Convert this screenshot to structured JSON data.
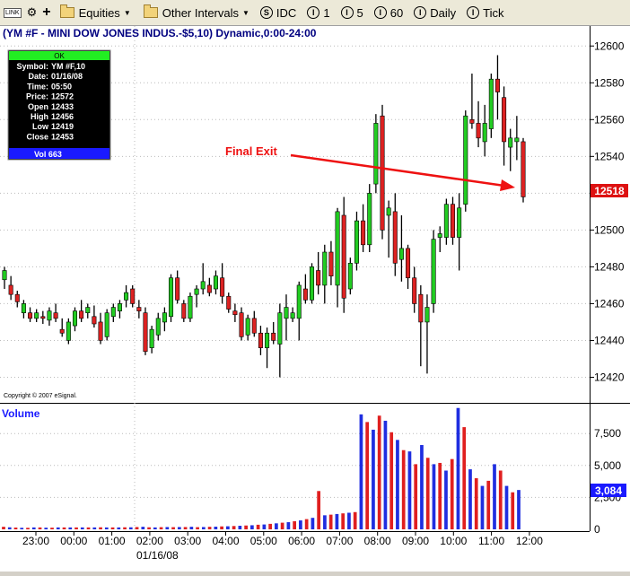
{
  "toolbar": {
    "link_label": "LINK",
    "items": [
      {
        "label": "Equities",
        "icon": "folder-icon",
        "dropdown": true
      },
      {
        "label": "Other Intervals",
        "icon": "folder-icon",
        "dropdown": true
      },
      {
        "label": "IDC",
        "icon": "S"
      },
      {
        "label": "1",
        "icon": "I"
      },
      {
        "label": "5",
        "icon": "I"
      },
      {
        "label": "60",
        "icon": "I"
      },
      {
        "label": "Daily",
        "icon": "I"
      },
      {
        "label": "Tick",
        "icon": "I"
      }
    ]
  },
  "chart_header": "(YM #F - MINI DOW JONES INDUS.-$5,10) Dynamic,0:00-24:00",
  "info_box": {
    "status": "OK",
    "rows": [
      [
        "Symbol:",
        "YM #F,10"
      ],
      [
        "Date:",
        "01/16/08"
      ],
      [
        "Time:",
        "05:50"
      ],
      [
        "Price:",
        "12572"
      ],
      [
        "Open",
        "12433"
      ],
      [
        "High",
        "12456"
      ],
      [
        "Low",
        "12419"
      ],
      [
        "Close",
        "12453"
      ]
    ],
    "vol": "Vol 663"
  },
  "annotation": "Final Exit",
  "copyright": "Copyright © 2007 eSignal.",
  "volume_label": "Volume",
  "last_price": "12518",
  "last_volume": "3,084",
  "date_label": "01/16/08",
  "colors": {
    "up": "#22cc22",
    "down": "#dd2222",
    "vol_up": "#1f2ee0",
    "vol_down": "#e01f1f",
    "arrow": "#ee1111",
    "header": "#000080"
  },
  "chart_data": [
    {
      "type": "candlestick",
      "ylim": [
        12410,
        12605
      ],
      "y_ticks": [
        12420,
        12440,
        12460,
        12480,
        12500,
        12520,
        12540,
        12560,
        12580,
        12600
      ],
      "x_ticks": [
        "23:00",
        "00:00",
        "01:00",
        "02:00",
        "03:00",
        "04:00",
        "05:00",
        "06:00",
        "07:00",
        "08:00",
        "09:00",
        "10:00",
        "11:00",
        "12:00"
      ],
      "candles": [
        [
          12473,
          12480,
          12468,
          12478
        ],
        [
          12470,
          12475,
          12462,
          12465
        ],
        [
          12465,
          12467,
          12458,
          12461
        ],
        [
          12455,
          12462,
          12452,
          12460
        ],
        [
          12455,
          12458,
          12450,
          12452
        ],
        [
          12452,
          12457,
          12450,
          12455
        ],
        [
          12453,
          12456,
          12449,
          12452
        ],
        [
          12451,
          12458,
          12448,
          12456
        ],
        [
          12455,
          12460,
          12450,
          12452
        ],
        [
          12446,
          12452,
          12442,
          12444
        ],
        [
          12440,
          12452,
          12438,
          12450
        ],
        [
          12448,
          12458,
          12445,
          12456
        ],
        [
          12456,
          12462,
          12450,
          12452
        ],
        [
          12455,
          12460,
          12452,
          12458
        ],
        [
          12453,
          12459,
          12447,
          12449
        ],
        [
          12450,
          12455,
          12438,
          12440
        ],
        [
          12442,
          12457,
          12440,
          12455
        ],
        [
          12453,
          12460,
          12450,
          12458
        ],
        [
          12456,
          12462,
          12452,
          12460
        ],
        [
          12462,
          12470,
          12458,
          12466
        ],
        [
          12468,
          12470,
          12458,
          12460
        ],
        [
          12458,
          12462,
          12452,
          12456
        ],
        [
          12455,
          12458,
          12432,
          12434
        ],
        [
          12436,
          12448,
          12433,
          12446
        ],
        [
          12443,
          12455,
          12440,
          12452
        ],
        [
          12450,
          12458,
          12445,
          12455
        ],
        [
          12453,
          12476,
          12450,
          12474
        ],
        [
          12474,
          12478,
          12460,
          12462
        ],
        [
          12460,
          12462,
          12450,
          12452
        ],
        [
          12452,
          12466,
          12450,
          12464
        ],
        [
          12465,
          12470,
          12458,
          12468
        ],
        [
          12468,
          12482,
          12465,
          12472
        ],
        [
          12470,
          12474,
          12464,
          12466
        ],
        [
          12468,
          12478,
          12465,
          12475
        ],
        [
          12474,
          12482,
          12460,
          12464
        ],
        [
          12464,
          12466,
          12455,
          12457
        ],
        [
          12456,
          12460,
          12450,
          12454
        ],
        [
          12455,
          12458,
          12440,
          12442
        ],
        [
          12443,
          12454,
          12440,
          12452
        ],
        [
          12452,
          12456,
          12442,
          12444
        ],
        [
          12444,
          12448,
          12432,
          12436
        ],
        [
          12436,
          12447,
          12425,
          12444
        ],
        [
          12444,
          12450,
          12438,
          12440
        ],
        [
          12438,
          12460,
          12420,
          12455
        ],
        [
          12452,
          12465,
          12440,
          12458
        ],
        [
          12452,
          12458,
          12450,
          12455
        ],
        [
          12452,
          12472,
          12440,
          12470
        ],
        [
          12468,
          12476,
          12460,
          12462
        ],
        [
          12462,
          12482,
          12460,
          12480
        ],
        [
          12478,
          12488,
          12465,
          12470
        ],
        [
          12470,
          12492,
          12460,
          12488
        ],
        [
          12488,
          12494,
          12470,
          12475
        ],
        [
          12470,
          12512,
          12458,
          12510
        ],
        [
          12508,
          12518,
          12455,
          12463
        ],
        [
          12468,
          12485,
          12465,
          12482
        ],
        [
          12482,
          12510,
          12478,
          12505
        ],
        [
          12505,
          12514,
          12488,
          12492
        ],
        [
          12492,
          12525,
          12488,
          12520
        ],
        [
          12525,
          12563,
          12520,
          12558
        ],
        [
          12562,
          12568,
          12495,
          12500
        ],
        [
          12508,
          12516,
          12485,
          12512
        ],
        [
          12510,
          12520,
          12475,
          12482
        ],
        [
          12484,
          12508,
          12472,
          12490
        ],
        [
          12490,
          12492,
          12468,
          12474
        ],
        [
          12474,
          12480,
          12455,
          12460
        ],
        [
          12465,
          12470,
          12426,
          12450
        ],
        [
          12450,
          12465,
          12422,
          12458
        ],
        [
          12460,
          12500,
          12455,
          12495
        ],
        [
          12496,
          12502,
          12488,
          12498
        ],
        [
          12496,
          12517,
          12492,
          12514
        ],
        [
          12514,
          12518,
          12492,
          12496
        ],
        [
          12496,
          12520,
          12478,
          12512
        ],
        [
          12514,
          12565,
          12510,
          12562
        ],
        [
          12560,
          12585,
          12555,
          12558
        ],
        [
          12558,
          12570,
          12545,
          12550
        ],
        [
          12548,
          12568,
          12540,
          12558
        ],
        [
          12555,
          12585,
          12550,
          12582
        ],
        [
          12582,
          12595,
          12560,
          12575
        ],
        [
          12572,
          12578,
          12535,
          12548
        ],
        [
          12545,
          12555,
          12532,
          12550
        ],
        [
          12548,
          12562,
          12538,
          12550
        ],
        [
          12548,
          12550,
          12515,
          12518
        ]
      ]
    },
    {
      "type": "bar",
      "ylim": [
        0,
        9200
      ],
      "y_ticks": [
        2500,
        5000,
        7500
      ],
      "values": [
        200,
        160,
        140,
        120,
        120,
        150,
        150,
        130,
        130,
        150,
        150,
        150,
        150,
        150,
        150,
        150,
        160,
        150,
        150,
        150,
        160,
        160,
        180,
        200,
        160,
        150,
        170,
        180,
        170,
        180,
        180,
        200,
        170,
        180,
        200,
        210,
        230,
        240,
        260,
        280,
        300,
        320,
        360,
        380,
        430,
        470,
        520,
        560,
        640,
        700,
        800,
        900,
        3000,
        1100,
        1150,
        1200,
        1250,
        1300,
        1350,
        9000,
        8400,
        7800,
        8900,
        8500,
        7600,
        7000,
        6200,
        6100,
        5100,
        6600,
        5600,
        5100,
        5200,
        4600,
        5500,
        9500,
        8000,
        4700,
        4000,
        3400,
        3800,
        5100,
        4600,
        3400,
        2900,
        3080
      ]
    }
  ]
}
